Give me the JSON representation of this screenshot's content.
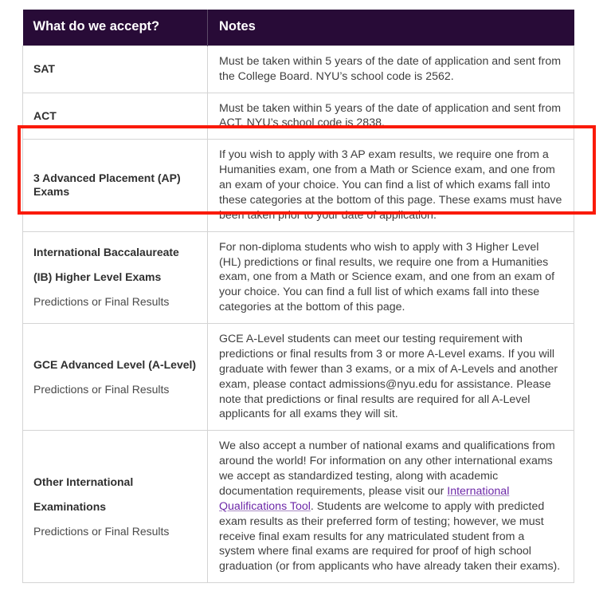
{
  "table": {
    "headers": {
      "col1": "What do we accept?",
      "col2": "Notes"
    },
    "rows": [
      {
        "id": "sat",
        "label_title": "SAT",
        "label_sub": "",
        "notes": "Must be taken within 5 years of the date of application and sent from the College Board. NYU’s school code is 2562."
      },
      {
        "id": "act",
        "label_title": "ACT",
        "label_sub": "",
        "notes": "Must be taken within 5 years of the date of application and sent from ACT. NYU’s school code is 2838."
      },
      {
        "id": "ap-exams",
        "label_title": "3 Advanced Placement (AP) Exams",
        "label_sub": "",
        "notes": "If you wish to apply with 3 AP exam results, we require one from a Humanities exam, one from a Math or Science exam, and one from an exam of your choice. You can find a list of which exams fall into these categories at the bottom of this page. These exams must have been taken prior to your date of application."
      },
      {
        "id": "ib-higher-level",
        "label_title": "International Baccalaureate (IB) Higher Level Exams",
        "label_sub": "Predictions or Final Results",
        "notes": "For non-diploma students who wish to apply with 3 Higher Level (HL) predictions or final results, we require one from a Humanities exam, one from a Math or Science exam, and one from an exam of your choice. You can find a full list of which exams fall into these categories at the bottom of this page."
      },
      {
        "id": "gce-a-level",
        "label_title": "GCE Advanced Level (A-Level)",
        "label_sub": "Predictions or Final Results",
        "notes_before_email": "GCE A-Level students can meet our testing requirement with predictions or final results from 3 or more A-Level exams. If you will graduate with fewer than 3 exams, or a mix of A-Levels and another exam, please contact ",
        "email": "admissions@nyu.edu",
        "notes_after_email": " for assistance. Please note that predictions or final results are required for all A-Level applicants for all exams they will sit."
      },
      {
        "id": "other-international",
        "label_title": "Other International Examinations",
        "label_sub": "Predictions or Final Results",
        "notes_before_link": "We also accept a number of national exams and qualifications from around the world! For information on any other international exams we accept as standardized testing, along with academic documentation requirements, please visit our ",
        "link_text": "International Qualifications Tool",
        "notes_after_link": ". Students are welcome to apply with predicted exam results as their preferred form of testing; however, we must receive final exam results for any matriculated student from a system where final exams are required for proof of high school graduation (or from applicants who have already taken their exams)."
      }
    ]
  },
  "annotation": {
    "highlight_target": "ap-exams-row",
    "highlight_color": "#fa1a09"
  },
  "colors": {
    "header_background": "#280b37",
    "header_text": "#ffffff",
    "body_text": "#3e3e3e",
    "label_text": "#2f2f2f",
    "sub_label_text": "#4a4a4a",
    "link": "#6d28a8",
    "border": "#d4d4d4",
    "highlight": "#fa1a09"
  }
}
